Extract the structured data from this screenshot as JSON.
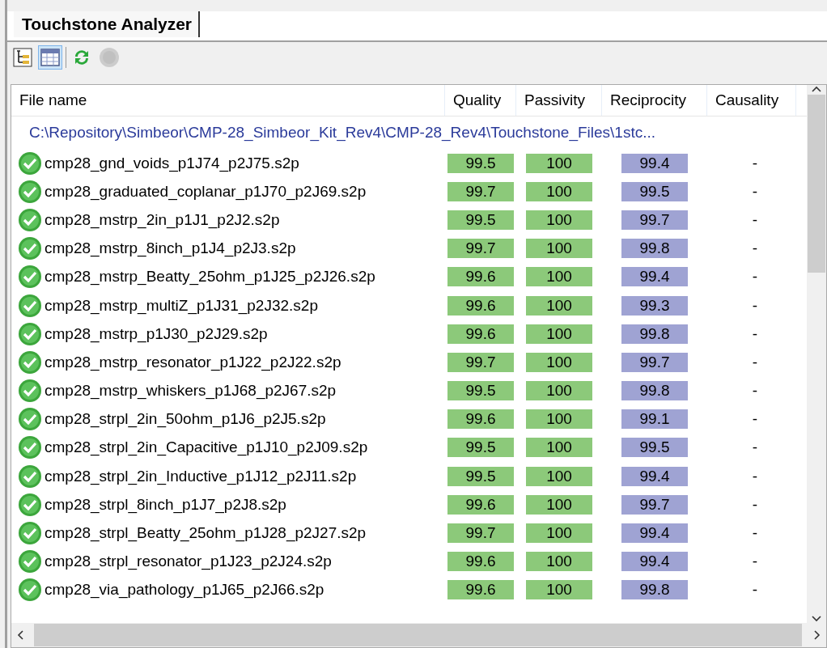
{
  "tab": {
    "label": "Touchstone Analyzer"
  },
  "toolbar": [
    {
      "kind": "tree",
      "selected": false
    },
    {
      "kind": "grid",
      "selected": true
    },
    {
      "kind": "refresh",
      "selected": false,
      "disabled": false
    },
    {
      "kind": "stop",
      "selected": false,
      "disabled": true
    }
  ],
  "table": {
    "columns": [
      {
        "label": "File name"
      },
      {
        "label": "Quality",
        "color": "#8cc97a"
      },
      {
        "label": "Passivity",
        "color": "#8cc97a"
      },
      {
        "label": "Reciprocity",
        "color": "#9fa3d3"
      },
      {
        "label": "Causality"
      }
    ],
    "group": "C:\\Repository\\Simbeor\\CMP-28_Simbeor_Kit_Rev4\\CMP-28_Rev4\\Touchstone_Files\\1stc...",
    "rows": [
      {
        "valid": true,
        "cells": [
          "cmp28_gnd_voids_p1J74_p2J75.s2p",
          "99.5",
          "100",
          "99.4",
          "-"
        ]
      },
      {
        "valid": true,
        "cells": [
          "cmp28_graduated_coplanar_p1J70_p2J69.s2p",
          "99.7",
          "100",
          "99.5",
          "-"
        ]
      },
      {
        "valid": true,
        "cells": [
          "cmp28_mstrp_2in_p1J1_p2J2.s2p",
          "99.5",
          "100",
          "99.7",
          "-"
        ]
      },
      {
        "valid": true,
        "cells": [
          "cmp28_mstrp_8inch_p1J4_p2J3.s2p",
          "99.7",
          "100",
          "99.8",
          "-"
        ]
      },
      {
        "valid": true,
        "cells": [
          "cmp28_mstrp_Beatty_25ohm_p1J25_p2J26.s2p",
          "99.6",
          "100",
          "99.4",
          "-"
        ]
      },
      {
        "valid": true,
        "cells": [
          "cmp28_mstrp_multiZ_p1J31_p2J32.s2p",
          "99.6",
          "100",
          "99.3",
          "-"
        ]
      },
      {
        "valid": true,
        "cells": [
          "cmp28_mstrp_p1J30_p2J29.s2p",
          "99.6",
          "100",
          "99.8",
          "-"
        ]
      },
      {
        "valid": true,
        "cells": [
          "cmp28_mstrp_resonator_p1J22_p2J22.s2p",
          "99.7",
          "100",
          "99.7",
          "-"
        ]
      },
      {
        "valid": true,
        "cells": [
          "cmp28_mstrp_whiskers_p1J68_p2J67.s2p",
          "99.5",
          "100",
          "99.8",
          "-"
        ]
      },
      {
        "valid": true,
        "cells": [
          "cmp28_strpl_2in_50ohm_p1J6_p2J5.s2p",
          "99.6",
          "100",
          "99.1",
          "-"
        ]
      },
      {
        "valid": true,
        "cells": [
          "cmp28_strpl_2in_Capacitive_p1J10_p2J09.s2p",
          "99.5",
          "100",
          "99.5",
          "-"
        ]
      },
      {
        "valid": true,
        "cells": [
          "cmp28_strpl_2in_Inductive_p1J12_p2J11.s2p",
          "99.5",
          "100",
          "99.4",
          "-"
        ]
      },
      {
        "valid": true,
        "cells": [
          "cmp28_strpl_8inch_p1J7_p2J8.s2p",
          "99.6",
          "100",
          "99.7",
          "-"
        ]
      },
      {
        "valid": true,
        "cells": [
          "cmp28_strpl_Beatty_25ohm_p1J28_p2J27.s2p",
          "99.7",
          "100",
          "99.4",
          "-"
        ]
      },
      {
        "valid": true,
        "cells": [
          "cmp28_strpl_resonator_p1J23_p2J24.s2p",
          "99.6",
          "100",
          "99.4",
          "-"
        ]
      },
      {
        "valid": true,
        "cells": [
          "cmp28_via_pathology_p1J65_p2J66.s2p",
          "99.6",
          "100",
          "99.8",
          "-"
        ]
      }
    ]
  }
}
